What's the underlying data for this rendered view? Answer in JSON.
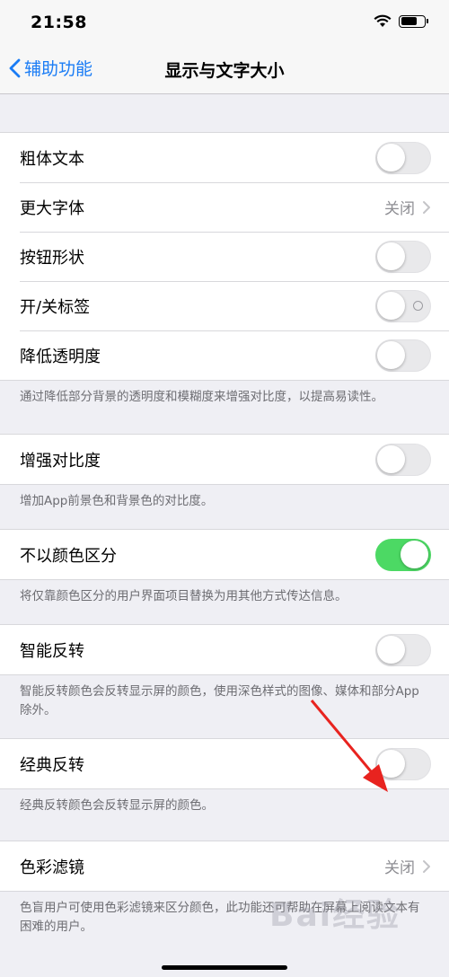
{
  "status_bar": {
    "time": "21:58"
  },
  "nav": {
    "back_label": "辅助功能",
    "title": "显示与文字大小"
  },
  "group1": {
    "rows": [
      {
        "label": "粗体文本",
        "toggle": "off"
      },
      {
        "label": "更大字体",
        "value": "关闭"
      },
      {
        "label": "按钮形状",
        "toggle": "off"
      },
      {
        "label": "开/关标签",
        "toggle": "off"
      },
      {
        "label": "降低透明度",
        "toggle": "off"
      }
    ],
    "footer": "通过降低部分背景的透明度和模糊度来增强对比度，以提高易读性。"
  },
  "group2": {
    "label": "增强对比度",
    "toggle": "off",
    "footer": "增加App前景色和背景色的对比度。"
  },
  "group3": {
    "label": "不以颜色区分",
    "toggle": "on",
    "footer": "将仅靠颜色区分的用户界面项目替换为用其他方式传达信息。"
  },
  "group4": {
    "label": "智能反转",
    "toggle": "off",
    "footer": "智能反转颜色会反转显示屏的颜色，使用深色样式的图像、媒体和部分App除外。"
  },
  "group5": {
    "label": "经典反转",
    "toggle": "off",
    "footer": "经典反转颜色会反转显示屏的颜色。"
  },
  "group6": {
    "label": "色彩滤镜",
    "value": "关闭",
    "footer": "色盲用户可使用色彩滤镜来区分颜色，此功能还可帮助在屏幕上阅读文本有困难的用户。"
  },
  "annotation": {
    "color": "#e8231f"
  },
  "watermark": "Bai经验"
}
